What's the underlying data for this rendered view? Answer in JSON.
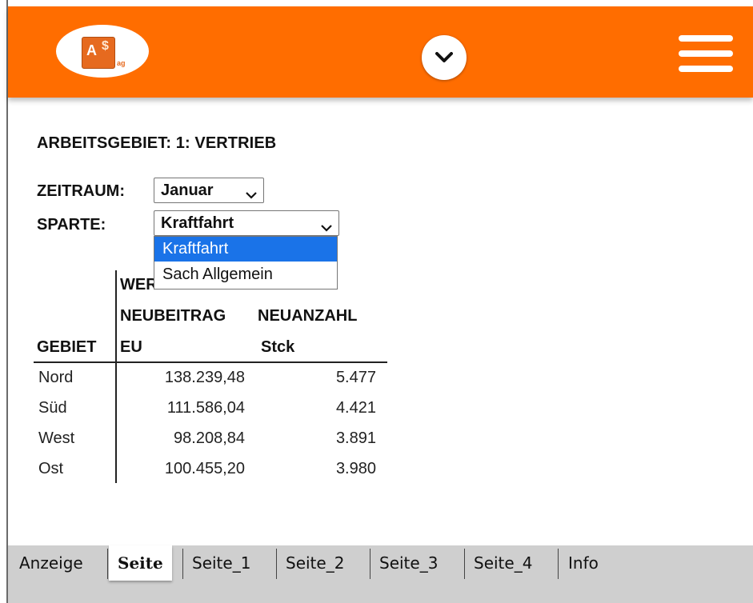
{
  "header": {
    "logo_text": "AS",
    "logo_subtext": "ag",
    "bg_color": "#ff6d00"
  },
  "main": {
    "title": "ARBEITSGEBIET: 1: VERTRIEB",
    "zeitraum_label": "ZEITRAUM:",
    "zeitraum_value": "Januar",
    "sparte_label": "SPARTE:",
    "sparte_value": "Kraftfahrt",
    "sparte_options": [
      "Kraftfahrt",
      "Sach Allgemein"
    ]
  },
  "table": {
    "group_header": "WERTE",
    "columns": [
      {
        "name": "GEBIET",
        "unit": ""
      },
      {
        "name": "NEUBEITRAG",
        "unit": "EU"
      },
      {
        "name": "NEUANZAHL",
        "unit": "Stck"
      }
    ],
    "rows": [
      {
        "gebiet": "Nord",
        "neubeitrag": "138.239,48",
        "neuanzahl": "5.477"
      },
      {
        "gebiet": "Süd",
        "neubeitrag": "111.586,04",
        "neuanzahl": "4.421"
      },
      {
        "gebiet": "West",
        "neubeitrag": "98.208,84",
        "neuanzahl": "3.891"
      },
      {
        "gebiet": "Ost",
        "neubeitrag": "100.455,20",
        "neuanzahl": "3.980"
      }
    ]
  },
  "tabs": [
    "Anzeige",
    "Seite",
    "Seite_1",
    "Seite_2",
    "Seite_3",
    "Seite_4",
    "Info"
  ],
  "active_tab": "Seite",
  "colors": {
    "accent": "#ff6d00",
    "selection": "#1a73e8",
    "tabbar": "#cfcfcf"
  }
}
